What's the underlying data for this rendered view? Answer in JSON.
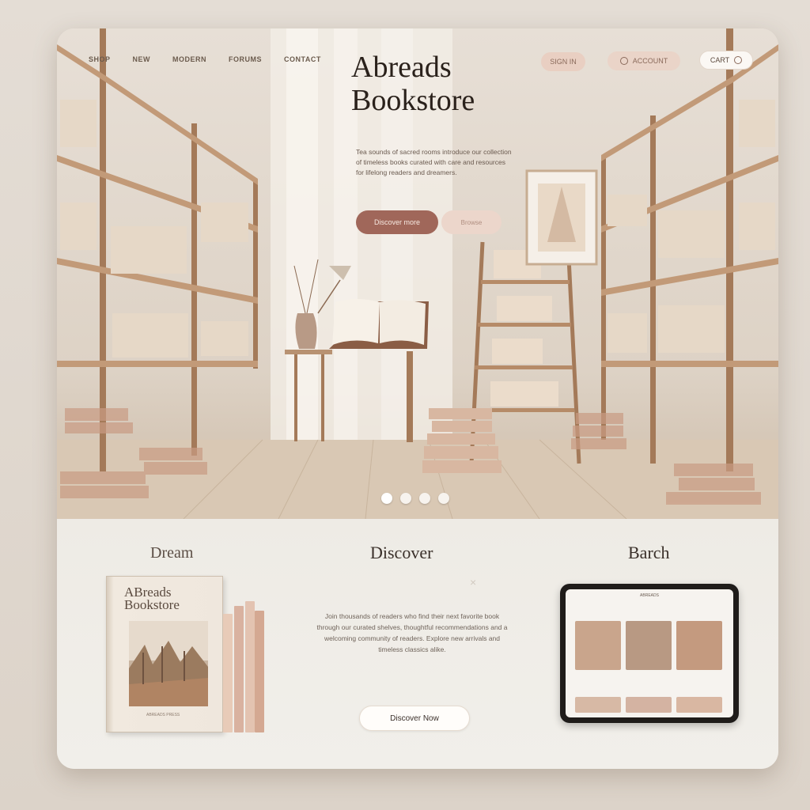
{
  "header": {
    "nav": [
      "SHOP",
      "NEW",
      "MODERN",
      "FORUMS",
      "CONTACT"
    ],
    "brand_line1": "Abreads",
    "brand_line2": "Bookstore",
    "pill_a": "SIGN IN",
    "pill_b": "ACCOUNT",
    "pill_c": "CART"
  },
  "hero": {
    "copy": "Tea sounds of sacred rooms introduce our collection of timeless books curated with care and resources for lifelong readers and dreamers.",
    "primary_button": "Discover more",
    "secondary_button": "Browse",
    "carousel_count": 4,
    "carousel_active": 0
  },
  "sections": {
    "dream_title": "Dream",
    "discover_title": "Discover",
    "search_title": "Barch",
    "book_title": "ABreads Bookstore",
    "book_footer": "ABREADS PRESS",
    "discover_copy": "Join thousands of readers who find their next favorite book through our curated shelves, thoughtful recommendations and a welcoming community of readers. Explore new arrivals and timeless classics alike.",
    "close_mark": "×",
    "cta_button": "Discover Now",
    "tablet_header": "ABREADS"
  },
  "colors": {
    "accent": "#a0675a",
    "accent_soft": "#ecd6cb",
    "background": "#eeebe6"
  }
}
